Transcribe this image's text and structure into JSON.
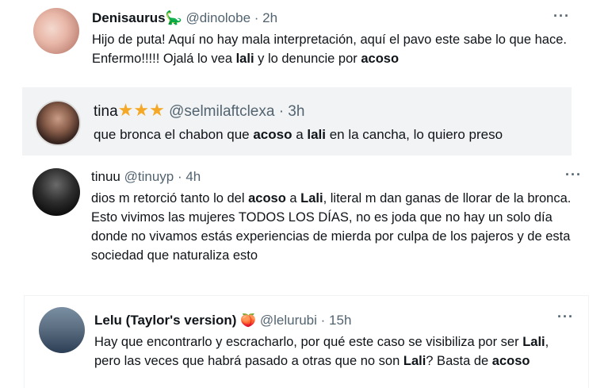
{
  "tweets": [
    {
      "name": "Denisaurus",
      "badge_icon": "dinosaur-icon",
      "handle": "@dinolobe",
      "time": "· 2h",
      "more": "···",
      "text_parts": {
        "p1": "Hijo de puta! Aquí no hay mala interpretación, aquí el pavo este sabe lo que hace. Enfermo!!!!! Ojalá lo vea ",
        "b1": "lali",
        "p2": " y lo denuncie por ",
        "b2": "acoso"
      }
    },
    {
      "name": "tina",
      "badge_icon": "three-stars-icon",
      "handle": "@selmilaftclexa",
      "time": "· 3h",
      "text_parts": {
        "p1": "que bronca el chabon que ",
        "b1": "acoso",
        "p2": " a ",
        "b2": "lali",
        "p3": " en la cancha, lo quiero preso"
      }
    },
    {
      "name": "tinuu",
      "handle": "@tinuyp",
      "time": "· 4h",
      "more": "···",
      "text_parts": {
        "p1": "dios m retorció tanto lo del ",
        "b1": "acoso",
        "p2": " a ",
        "b2": "Lali",
        "p3": ", literal m dan ganas de llorar de la bronca. Esto vivimos las mujeres TODOS LOS DÍAS, no es joda que no hay un solo día donde no vivamos estás experiencias de mierda por culpa de los pajeros y de esta sociedad que naturaliza esto"
      }
    },
    {
      "name": "Lelu (Taylor's version)",
      "badge_icon": "peach-icon",
      "handle": "@lelurubi",
      "time": "· 15h",
      "more": "···",
      "text_parts": {
        "p1": "Hay que encontrarlo y escracharlo, por qué este caso se visibiliza por ser ",
        "b1": "Lali",
        "p2": ", pero las veces que habrá pasado a otras que no son ",
        "b2": "Lali",
        "p3": "? Basta de ",
        "b3": "acoso"
      }
    }
  ]
}
